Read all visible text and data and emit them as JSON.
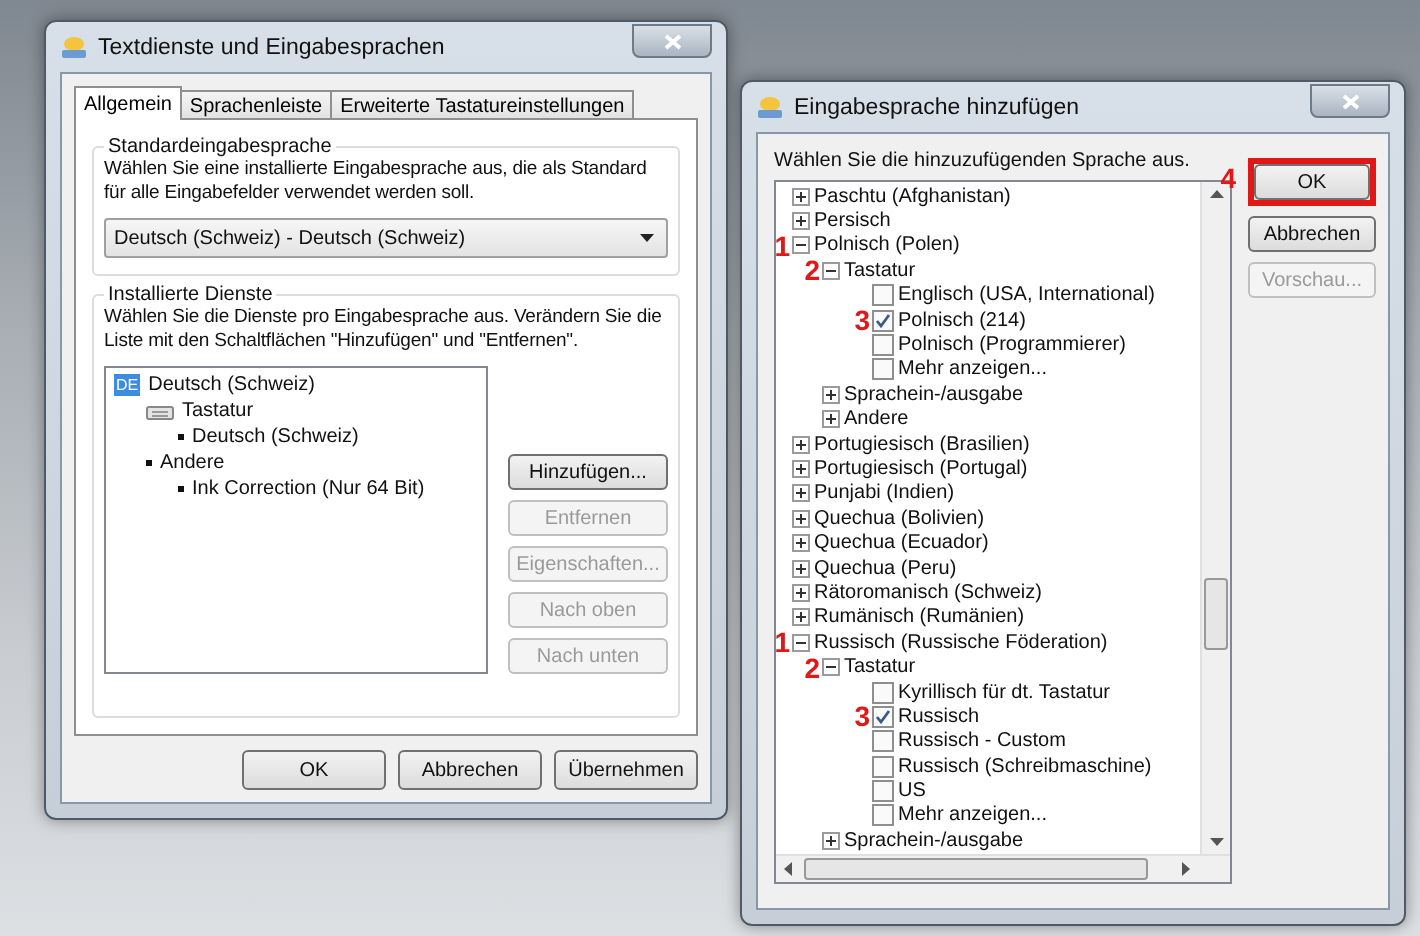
{
  "settings_dialog": {
    "title": "Textdienste und Eingabesprachen",
    "tabs": [
      {
        "label": "Allgemein",
        "selected": true
      },
      {
        "label": "Sprachenleiste",
        "selected": false
      },
      {
        "label": "Erweiterte Tastatureinstellungen",
        "selected": false
      }
    ],
    "default_language": {
      "heading": "Standardeingabesprache",
      "description": "Wählen Sie eine installierte Eingabesprache aus, die als Standard für alle Eingabefelder verwendet werden soll.",
      "value": "Deutsch (Schweiz) - Deutsch (Schweiz)"
    },
    "installed_services": {
      "heading": "Installierte Dienste",
      "description": "Wählen Sie die Dienste pro Eingabesprache aus. Verändern Sie die Liste mit den Schaltflächen \"Hinzufügen\" und \"Entfernen\".",
      "tree": [
        {
          "kind": "language",
          "badge": "DE",
          "label": "Deutsch (Schweiz)",
          "children": [
            {
              "kind": "keyboard",
              "label": "Tastatur",
              "children": [
                {
                  "kind": "bullet",
                  "label": "Deutsch (Schweiz)"
                }
              ]
            },
            {
              "kind": "bullet",
              "label": "Andere",
              "children": [
                {
                  "kind": "bullet",
                  "label": "Ink Correction (Nur 64 Bit)"
                }
              ]
            }
          ]
        }
      ],
      "buttons": [
        {
          "label": "Hinzufügen...",
          "disabled": false
        },
        {
          "label": "Entfernen",
          "disabled": true
        },
        {
          "label": "Eigenschaften...",
          "disabled": true
        },
        {
          "label": "Nach oben",
          "disabled": true
        },
        {
          "label": "Nach unten",
          "disabled": true
        }
      ]
    },
    "footer_buttons": [
      "OK",
      "Abbrechen",
      "Übernehmen"
    ]
  },
  "add_dialog": {
    "title": "Eingabesprache hinzufügen",
    "instruction": "Wählen Sie die hinzuzufügenden Sprache aus.",
    "tree": [
      {
        "kind": "group",
        "label": "Paschtu (Afghanistan)",
        "expanded": false
      },
      {
        "kind": "group",
        "label": "Persisch",
        "expanded": false
      },
      {
        "kind": "group",
        "label": "Polnisch (Polen)",
        "expanded": true,
        "marker": "1",
        "children": [
          {
            "kind": "group",
            "label": "Tastatur",
            "expanded": true,
            "marker": "2",
            "children": [
              {
                "kind": "option",
                "label": "Englisch (USA, International)",
                "checked": false
              },
              {
                "kind": "option",
                "label": "Polnisch (214)",
                "checked": true,
                "marker": "3"
              },
              {
                "kind": "option",
                "label": "Polnisch (Programmierer)",
                "checked": false
              },
              {
                "kind": "option",
                "label": "Mehr anzeigen...",
                "checked": false
              }
            ]
          },
          {
            "kind": "group",
            "label": "Sprachein-/ausgabe",
            "expanded": false
          },
          {
            "kind": "group",
            "label": "Andere",
            "expanded": false
          }
        ]
      },
      {
        "kind": "group",
        "label": "Portugiesisch (Brasilien)",
        "expanded": false
      },
      {
        "kind": "group",
        "label": "Portugiesisch (Portugal)",
        "expanded": false
      },
      {
        "kind": "group",
        "label": "Punjabi (Indien)",
        "expanded": false
      },
      {
        "kind": "group",
        "label": "Quechua (Bolivien)",
        "expanded": false
      },
      {
        "kind": "group",
        "label": "Quechua (Ecuador)",
        "expanded": false
      },
      {
        "kind": "group",
        "label": "Quechua (Peru)",
        "expanded": false
      },
      {
        "kind": "group",
        "label": "Rätoromanisch (Schweiz)",
        "expanded": false
      },
      {
        "kind": "group",
        "label": "Rumänisch (Rumänien)",
        "expanded": false
      },
      {
        "kind": "group",
        "label": "Russisch (Russische Föderation)",
        "expanded": true,
        "marker": "1",
        "children": [
          {
            "kind": "group",
            "label": "Tastatur",
            "expanded": true,
            "marker": "2",
            "children": [
              {
                "kind": "option",
                "label": "Kyrillisch für dt. Tastatur",
                "checked": false
              },
              {
                "kind": "option",
                "label": "Russisch",
                "checked": true,
                "marker": "3"
              },
              {
                "kind": "option",
                "label": "Russisch - Custom",
                "checked": false
              },
              {
                "kind": "option",
                "label": "Russisch (Schreibmaschine)",
                "checked": false
              },
              {
                "kind": "option",
                "label": "US",
                "checked": false
              },
              {
                "kind": "option",
                "label": "Mehr anzeigen...",
                "checked": false
              }
            ]
          },
          {
            "kind": "group",
            "label": "Sprachein-/ausgabe",
            "expanded": false
          }
        ]
      }
    ],
    "buttons": [
      {
        "label": "OK",
        "disabled": false,
        "marker": "4"
      },
      {
        "label": "Abbrechen",
        "disabled": false
      },
      {
        "label": "Vorschau...",
        "disabled": true
      }
    ]
  }
}
